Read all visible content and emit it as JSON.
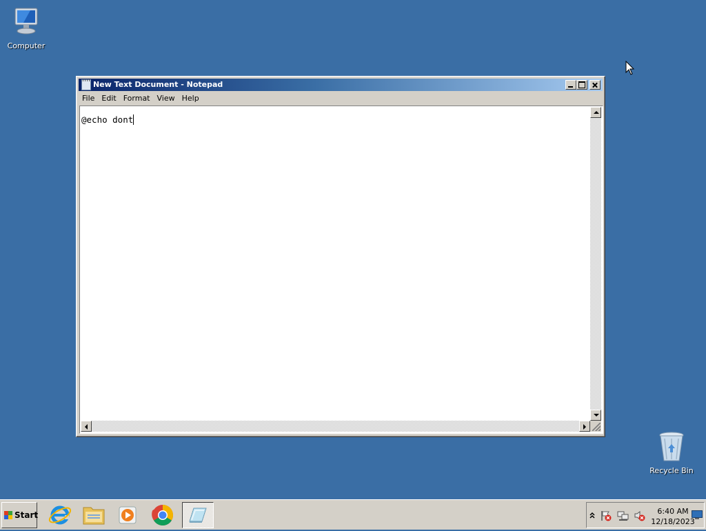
{
  "desktop": {
    "icons": [
      {
        "label": "Computer"
      },
      {
        "label": "Recycle Bin"
      }
    ]
  },
  "notepad": {
    "title": "New Text Document - Notepad",
    "menu": [
      "File",
      "Edit",
      "Format",
      "View",
      "Help"
    ],
    "content": "@echo dont"
  },
  "taskbar": {
    "start_label": "Start",
    "pinned": [
      {
        "icon": "internet-explorer-icon"
      },
      {
        "icon": "file-explorer-icon"
      },
      {
        "icon": "media-player-icon"
      },
      {
        "icon": "chrome-icon"
      },
      {
        "icon": "notepad-icon",
        "active": true
      }
    ],
    "tray": {
      "time": "6:40 AM",
      "date": "12/18/2023",
      "icons": [
        "show-hidden-icons",
        "action-center-flag-icon",
        "network-icon",
        "volume-muted-icon",
        "show-desktop-icon"
      ]
    }
  },
  "colors": {
    "desktop": "#3a6ea5",
    "titlebar_start": "#0a246a",
    "titlebar_end": "#a6caf0"
  }
}
